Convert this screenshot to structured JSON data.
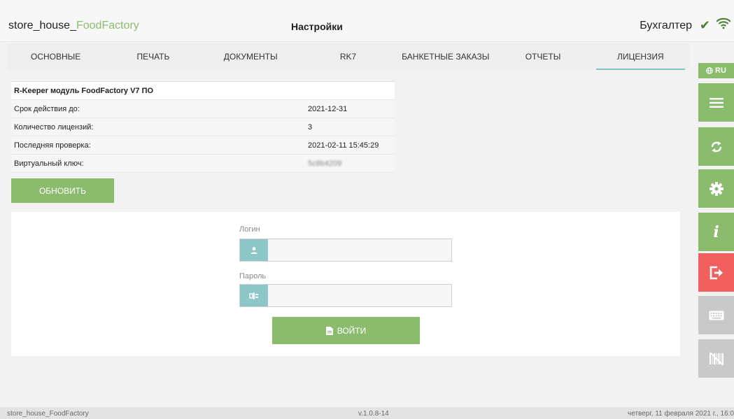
{
  "header": {
    "app_title_main": "store_house_",
    "app_title_accent": "FoodFactory",
    "page_title": "Настройки",
    "user_role": "Бухгалтер",
    "status_icon": "check-icon",
    "network_icon": "wifi-icon"
  },
  "tabs": [
    {
      "label": "ОСНОВНЫЕ",
      "active": false
    },
    {
      "label": "ПЕЧАТЬ",
      "active": false
    },
    {
      "label": "ДОКУМЕНТЫ",
      "active": false
    },
    {
      "label": "RK7",
      "active": false
    },
    {
      "label": "БАНКЕТНЫЕ ЗАКАЗЫ",
      "active": false
    },
    {
      "label": "ОТЧЕТЫ",
      "active": false
    },
    {
      "label": "ЛИЦЕНЗИЯ",
      "active": true
    }
  ],
  "license": {
    "heading": "R-Keeper модуль FoodFactory V7 ПО",
    "rows": [
      {
        "label": "Срок действия до:",
        "value": "2021-12-31"
      },
      {
        "label": "Количество лицензий:",
        "value": "3"
      },
      {
        "label": "Последняя проверка:",
        "value": "2021-02-11 15:45:29"
      },
      {
        "label": "Виртуальный ключ:",
        "value": "5c8b4209"
      }
    ],
    "refresh_label": "ОБНОВИТЬ"
  },
  "login": {
    "login_label": "Логин",
    "login_value": "",
    "password_label": "Пароль",
    "password_value": "",
    "submit_label": "ВОЙТИ",
    "login_icon": "user-icon",
    "password_icon": "key-icon",
    "submit_icon": "document-icon"
  },
  "rail": {
    "lang_label": "RU",
    "lang_icon": "globe-icon",
    "buttons": [
      "menu-icon",
      "sync-icon",
      "gear-icon",
      "info-icon",
      "logout-icon",
      "keyboard-icon",
      "barcode-icon"
    ]
  },
  "footer": {
    "left": "store_house_FoodFactory",
    "center": "v.1.0.8-14",
    "right": "четверг, 11 февраля 2021 г., 16:0"
  },
  "colors": {
    "accent_green": "#8bbc6e",
    "accent_teal": "#8cc6c6",
    "danger_red": "#f25f5f",
    "disabled_gray": "#c9c9c9",
    "check_green": "#4a7d2c"
  }
}
